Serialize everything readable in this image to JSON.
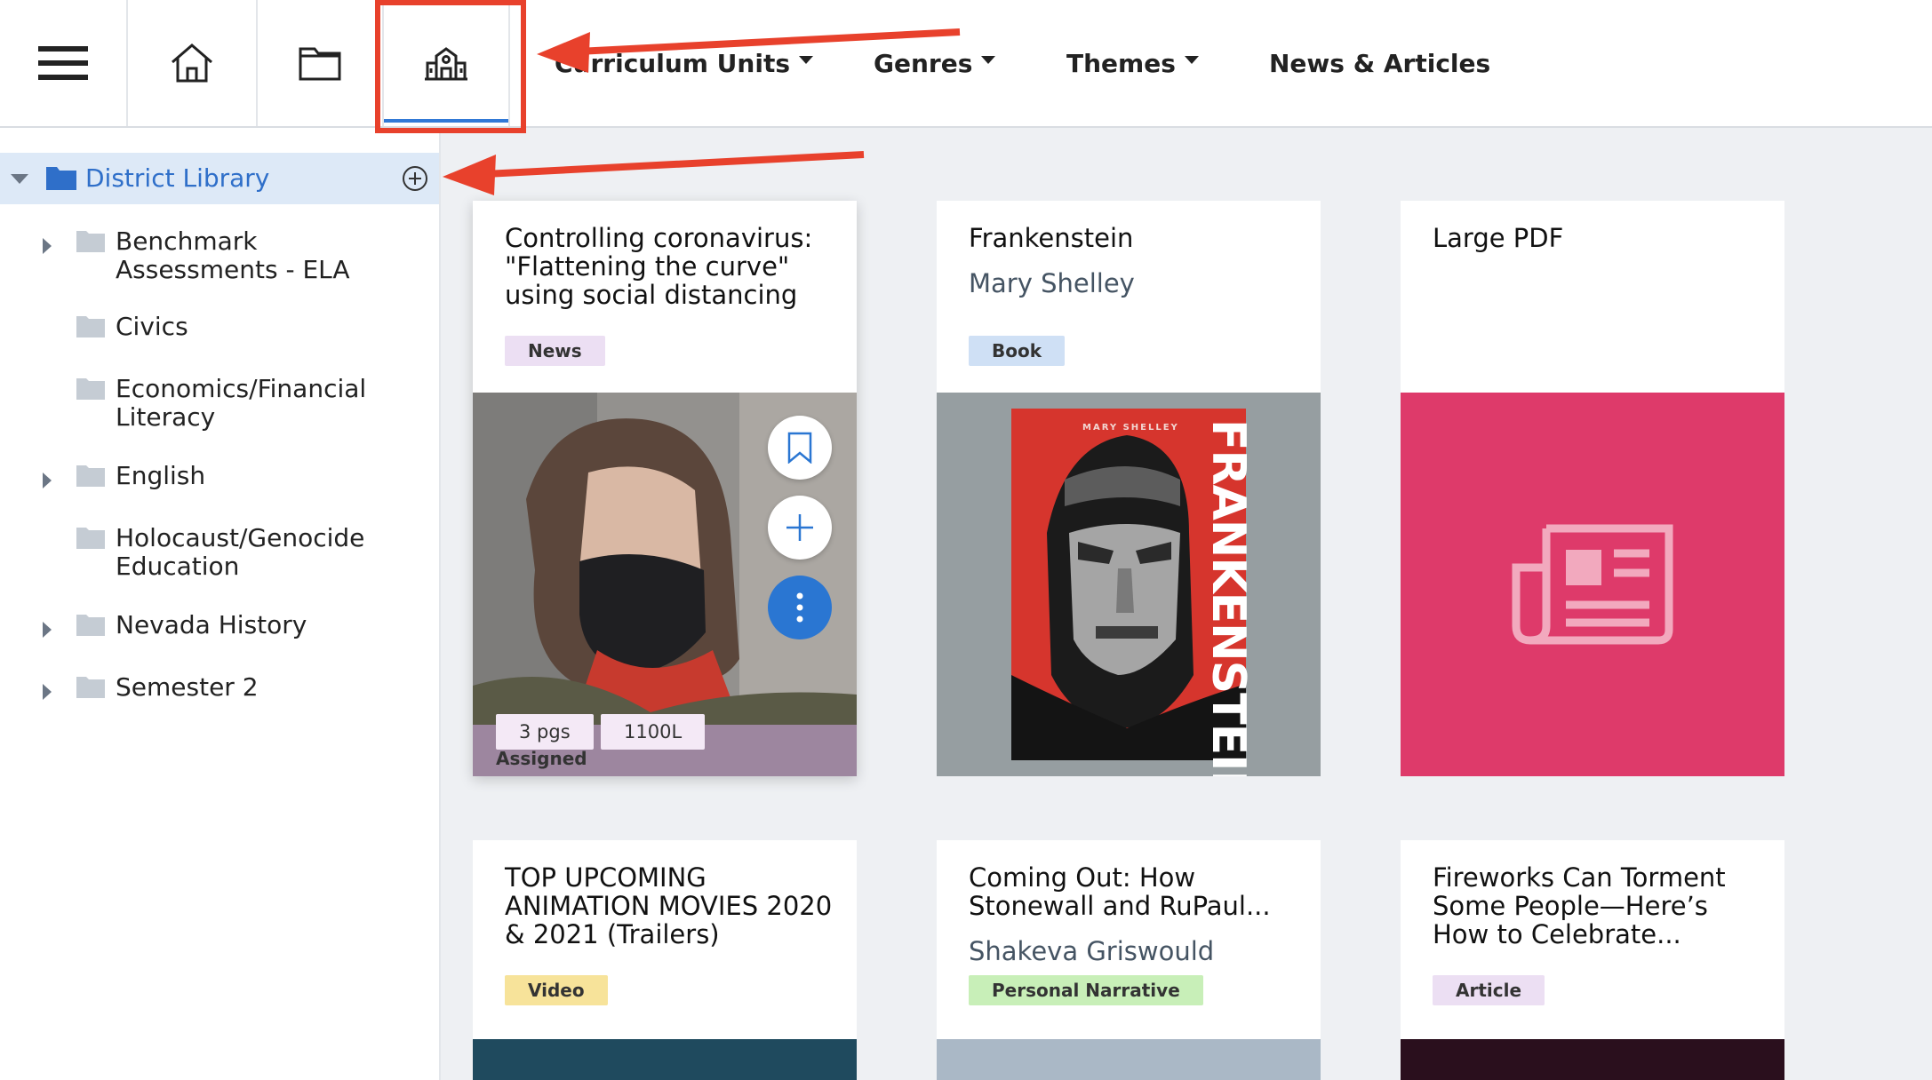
{
  "topnav": {
    "items": [
      {
        "label": "Curriculum Units",
        "dropdown": true
      },
      {
        "label": "Genres",
        "dropdown": true
      },
      {
        "label": "Themes",
        "dropdown": true
      },
      {
        "label": "News & Articles",
        "dropdown": false
      }
    ],
    "icons": [
      "menu-icon",
      "home-icon",
      "folder-icon",
      "school-building-icon"
    ]
  },
  "sidebar": {
    "root": {
      "label": "District Library",
      "expanded": true,
      "color": "#2f6fc9"
    },
    "items": [
      {
        "label": "Benchmark Assessments - ELA",
        "has_children": true
      },
      {
        "label": "Civics",
        "has_children": false
      },
      {
        "label": "Economics/Financial Literacy",
        "has_children": false
      },
      {
        "label": "English",
        "has_children": true
      },
      {
        "label": "Holocaust/Genocide Education",
        "has_children": false
      },
      {
        "label": "Nevada History",
        "has_children": true
      },
      {
        "label": "Semester 2",
        "has_children": true
      }
    ]
  },
  "cards": [
    {
      "title": "Controlling coronavirus: \"Flattening the curve\" using social distancing",
      "author": "",
      "tag": "News",
      "tag_color": "#ecdff3",
      "pages": "3 pgs",
      "lexile": "1100L",
      "status": "Assigned"
    },
    {
      "title": "Frankenstein",
      "author": "Mary Shelley",
      "tag": "Book",
      "tag_color": "#cfe0f5",
      "cover_author": "MARY SHELLEY",
      "cover_title": "FRANKENSTEIN"
    },
    {
      "title": "Large PDF",
      "author": "",
      "tag": "",
      "tag_color": "",
      "media_color": "#de3a6a"
    },
    {
      "title": "TOP UPCOMING ANIMATION MOVIES 2020 & 2021 (Trailers)",
      "author": "",
      "tag": "Video",
      "tag_color": "#f7e39a"
    },
    {
      "title": "Coming Out: How Stonewall and RuPaul...",
      "author": "Shakeva Griswould",
      "tag": "Personal Narrative",
      "tag_color": "#c8efb8"
    },
    {
      "title": "Fireworks Can Torment Some People—Here’s How to Celebrate...",
      "author": "",
      "tag": "Article",
      "tag_color": "#ecdff3"
    }
  ],
  "colors": {
    "accent": "#2a76d2",
    "annotation_red": "#e8412c"
  }
}
